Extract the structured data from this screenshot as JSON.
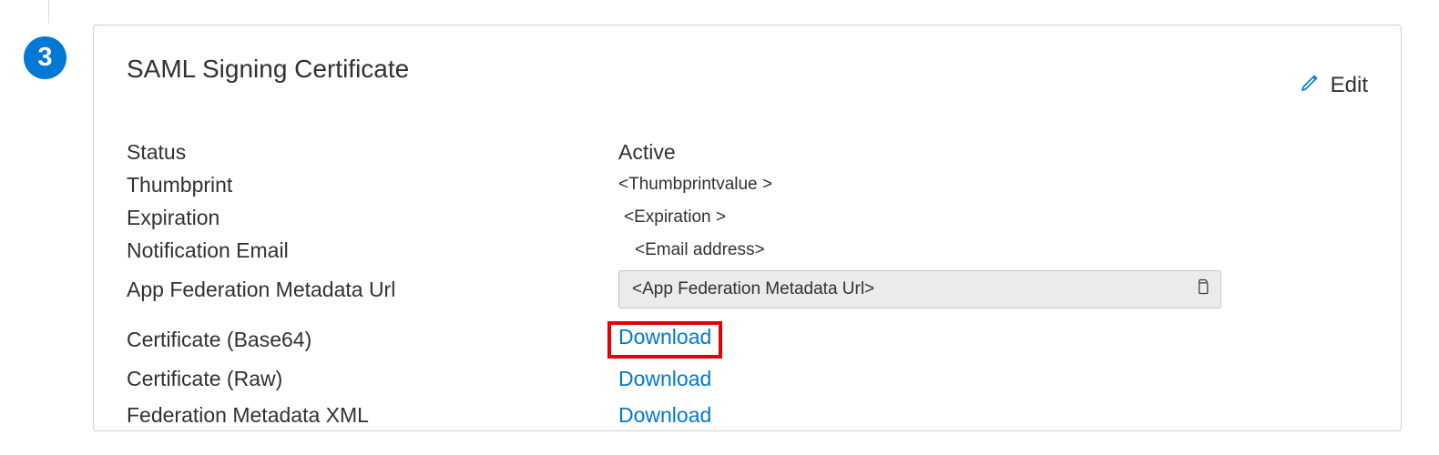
{
  "step": {
    "number": "3"
  },
  "card": {
    "title": "SAML Signing Certificate",
    "edit_label": "Edit"
  },
  "fields": {
    "status": {
      "label": "Status",
      "value": "Active"
    },
    "thumbprint": {
      "label": "Thumbprint",
      "value": "<Thumbprintvalue >"
    },
    "expiration": {
      "label": "Expiration",
      "value": "<Expiration >"
    },
    "notification_email": {
      "label": "Notification Email",
      "value": "<Email address>"
    },
    "app_federation_url": {
      "label": "App Federation Metadata Url",
      "value": "<App Federation  Metadata Url>"
    },
    "cert_base64": {
      "label": "Certificate (Base64)",
      "action": "Download"
    },
    "cert_raw": {
      "label": "Certificate (Raw)",
      "action": "Download"
    },
    "federation_xml": {
      "label": "Federation Metadata XML",
      "action": "Download"
    }
  }
}
